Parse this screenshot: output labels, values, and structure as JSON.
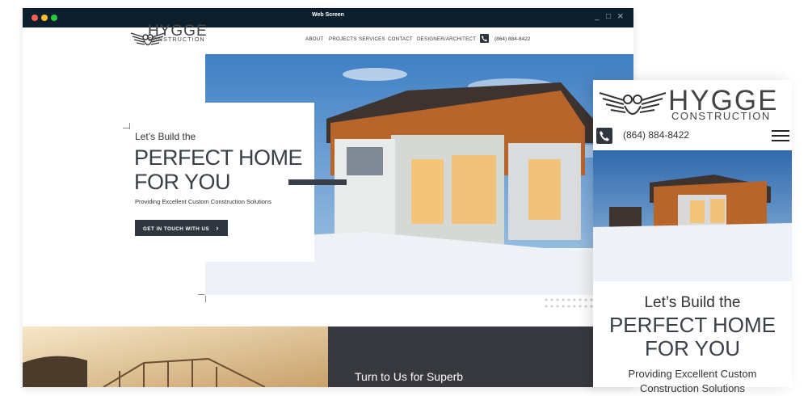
{
  "window": {
    "title": "Web Screen",
    "controls": {
      "minimize": "_",
      "maximize": "□",
      "close": "×"
    },
    "traffic_lights": [
      "#ff5f57",
      "#febc2e",
      "#28c840"
    ]
  },
  "brand": {
    "name": "HYGGE",
    "subtitle": "CONSTRUCTION",
    "logo_icon": "owl-logo-icon"
  },
  "nav": {
    "items": [
      "ABOUT",
      "PROJECTS",
      "SERVICES",
      "CONTACT",
      "DESIGNER/ARCHITECT"
    ],
    "phone": "(864) 884-8422"
  },
  "hero": {
    "small": "Let’s Build the",
    "big_line1": "PERFECT HOME",
    "big_line2": "FOR YOU",
    "sub": "Providing Excellent Custom Construction Solutions",
    "cta": "GET IN TOUCH WITH US",
    "cta_arrow": "›"
  },
  "section2": {
    "heading": "Turn to Us for Superb"
  },
  "mobile": {
    "brand": "HYGGE",
    "brand_sub": "CONSTRUCTION",
    "phone": "(864) 884-8422",
    "menu_icon": "hamburger-menu-icon",
    "small": "Let’s Build the",
    "big_line1": "PERFECT HOME",
    "big_line2": "FOR YOU",
    "sub_line1": "Providing Excellent Custom",
    "sub_line2": "Construction Solutions"
  },
  "colors": {
    "dark": "#2f3640",
    "titlebar": "#0d1f2d",
    "section_dark": "#37393f"
  }
}
